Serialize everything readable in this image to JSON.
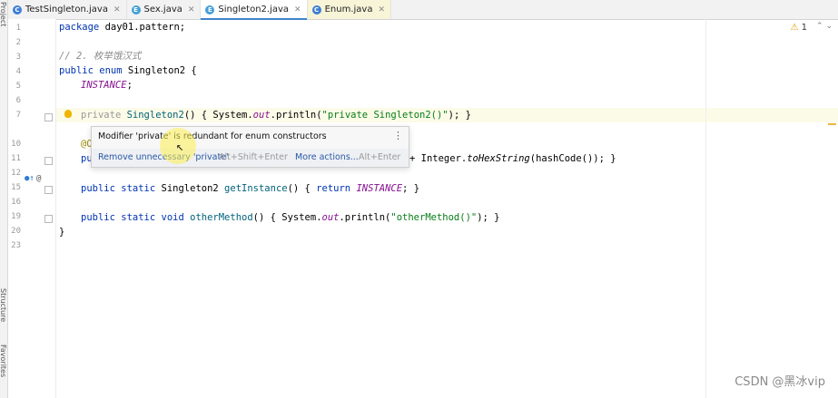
{
  "tabs": [
    {
      "label": "TestSingleton.java",
      "icon": "C",
      "color": "#3c7dd6"
    },
    {
      "label": "Sex.java",
      "icon": "E",
      "color": "#45a0d6"
    },
    {
      "label": "Singleton2.java",
      "icon": "E",
      "color": "#45a0d6"
    },
    {
      "label": "Enum.java",
      "icon": "C",
      "color": "#3c7dd6"
    }
  ],
  "sidebar": {
    "project": "Project",
    "structure": "Structure",
    "favorites": "Favorites"
  },
  "line_numbers": [
    "1",
    "2",
    "3",
    "4",
    "5",
    "6",
    "7",
    "10",
    "11",
    "12",
    "15",
    "16",
    "19",
    "20",
    "23"
  ],
  "code": {
    "l1_kw": "package",
    "l1_rest": " day01.pattern;",
    "l3": "// 2. 枚举饿汉式",
    "l4_kw1": "public",
    "l4_kw2": " enum",
    "l4_rest": " Singleton2 {",
    "l5": "INSTANCE",
    "l5_end": ";",
    "l7_kw": "priv",
    "l7_kw2": "ate",
    "l7_fn": " Singleton2",
    "l7_a": "() { System.",
    "l7_out": "out",
    "l7_b": ".println(",
    "l7_str": "\"private Singleton2()\"",
    "l7_c": "); }",
    "l10": "@O",
    "l12_a": "pu",
    "l12_b": "+ Integer.",
    "l12_m": "toHexString",
    "l12_c": "(hashCode()); }",
    "l16_kw": "public static",
    "l16_a": " Singleton2 ",
    "l16_fn": "getInstance",
    "l16_b": "() { ",
    "l16_ret": "return",
    "l16_inst": " INSTANCE",
    "l16_c": "; }",
    "l20_kw": "public static void",
    "l20_fn": " otherMethod",
    "l20_a": "() { System.",
    "l20_out": "out",
    "l20_b": ".println(",
    "l20_str": "\"otherMethod()\"",
    "l20_c": "); }",
    "l23": "}"
  },
  "popup": {
    "message": "Modifier 'private' is redundant for enum constructors",
    "action1": "Remove unnecessary 'private'",
    "shortcut1": "Alt+Shift+Enter",
    "action2": "More actions...",
    "shortcut2": "Alt+Enter"
  },
  "inspection": {
    "warnings": "1"
  },
  "watermark": "CSDN @黑冰vip"
}
